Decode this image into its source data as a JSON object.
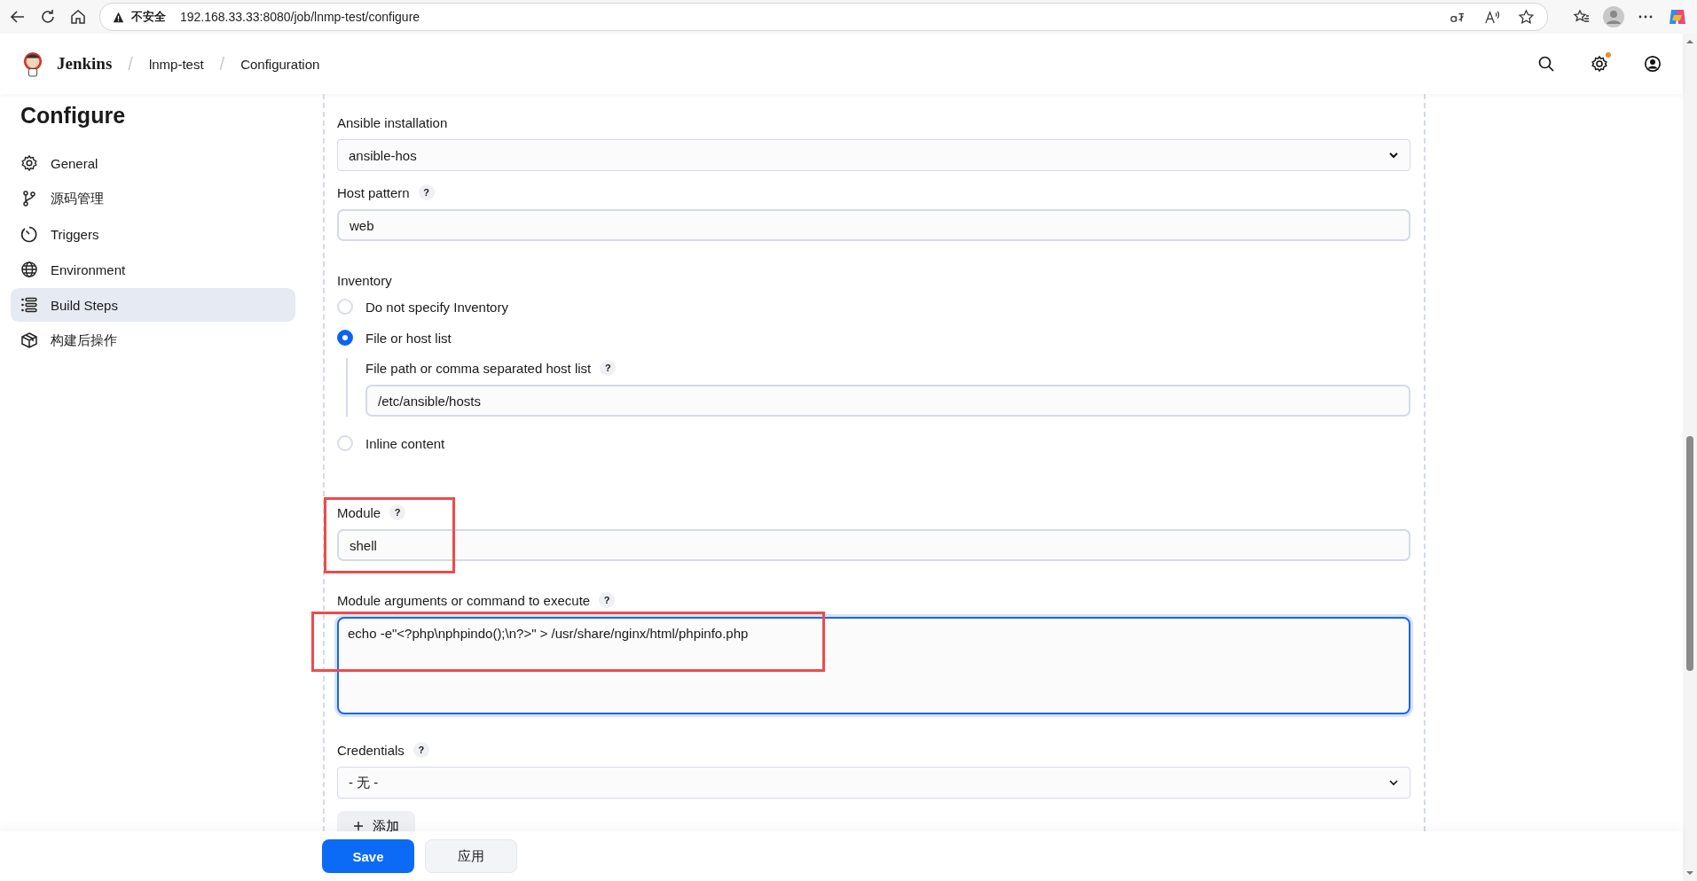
{
  "browser": {
    "security_label": "不安全",
    "url": "192.168.33.33:8080/job/lnmp-test/configure"
  },
  "header": {
    "brand": "Jenkins",
    "separator": "/",
    "breadcrumbs": [
      "lnmp-test",
      "Configuration"
    ],
    "settings_notification": true
  },
  "sidebar": {
    "title": "Configure",
    "items": [
      {
        "label": "General",
        "selected": false
      },
      {
        "label": "源码管理",
        "selected": false
      },
      {
        "label": "Triggers",
        "selected": false
      },
      {
        "label": "Environment",
        "selected": false
      },
      {
        "label": "Build Steps",
        "selected": true
      },
      {
        "label": "构建后操作",
        "selected": false
      }
    ]
  },
  "form": {
    "ansible_installation": {
      "label": "Ansible installation",
      "value": "ansible-hos"
    },
    "host_pattern": {
      "label": "Host pattern",
      "help": "?",
      "value": "web"
    },
    "inventory": {
      "label": "Inventory",
      "options": [
        {
          "label": "Do not specify Inventory",
          "selected": false
        },
        {
          "label": "File or host list",
          "selected": true,
          "field": {
            "label": "File path or comma separated host list",
            "help": "?",
            "value": "/etc/ansible/hosts"
          }
        },
        {
          "label": "Inline content",
          "selected": false
        }
      ]
    },
    "module": {
      "label": "Module",
      "help": "?",
      "value": "shell"
    },
    "module_arguments": {
      "label": "Module arguments or command to execute",
      "help": "?",
      "value": "echo -e\"<?php\\nphpindo();\\n?>\" > /usr/share/nginx/html/phpinfo.php",
      "focused": true
    },
    "credentials": {
      "label": "Credentials",
      "help": "?",
      "value": "- 无 -"
    },
    "add_button": "添加"
  },
  "footer": {
    "save": "Save",
    "apply": "应用"
  }
}
